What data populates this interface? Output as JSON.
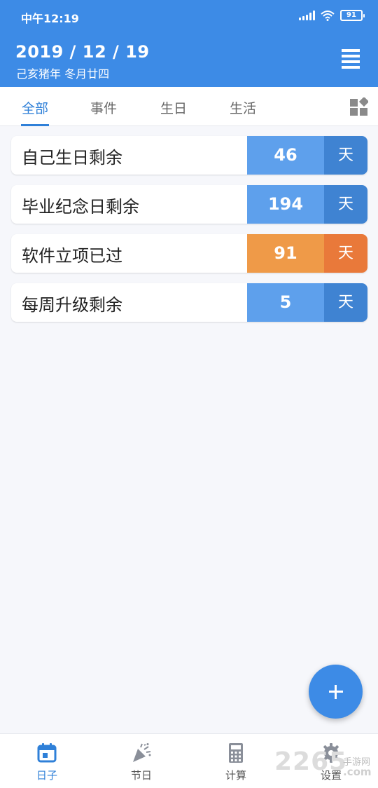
{
  "status": {
    "time": "中午12:19",
    "battery": "91"
  },
  "header": {
    "date": "2019 / 12 / 19",
    "lunar": "己亥猪年 冬月廿四"
  },
  "tabs": [
    {
      "label": "全部"
    },
    {
      "label": "事件"
    },
    {
      "label": "生日"
    },
    {
      "label": "生活"
    }
  ],
  "events": [
    {
      "title": "自己生日剩余",
      "count": "46",
      "unit": "天",
      "count_color": "#5ea0ec",
      "unit_color": "#3f83d2"
    },
    {
      "title": "毕业纪念日剩余",
      "count": "194",
      "unit": "天",
      "count_color": "#5ea0ec",
      "unit_color": "#3f83d2"
    },
    {
      "title": "软件立项已过",
      "count": "91",
      "unit": "天",
      "count_color": "#ef9a48",
      "unit_color": "#e9793a"
    },
    {
      "title": "每周升级剩余",
      "count": "5",
      "unit": "天",
      "count_color": "#5ea0ec",
      "unit_color": "#3f83d2"
    }
  ],
  "bottom_nav": [
    {
      "label": "日子",
      "icon": "calendar-icon"
    },
    {
      "label": "节日",
      "icon": "party-popper-icon"
    },
    {
      "label": "计算",
      "icon": "calculator-icon"
    },
    {
      "label": "设置",
      "icon": "gear-icon"
    }
  ],
  "watermark": {
    "number": "2265",
    "text": "手游网",
    "url": ".com"
  },
  "colors": {
    "primary": "#3d8be6",
    "accent_blue": "#5ea0ec",
    "accent_orange": "#ef9a48"
  }
}
